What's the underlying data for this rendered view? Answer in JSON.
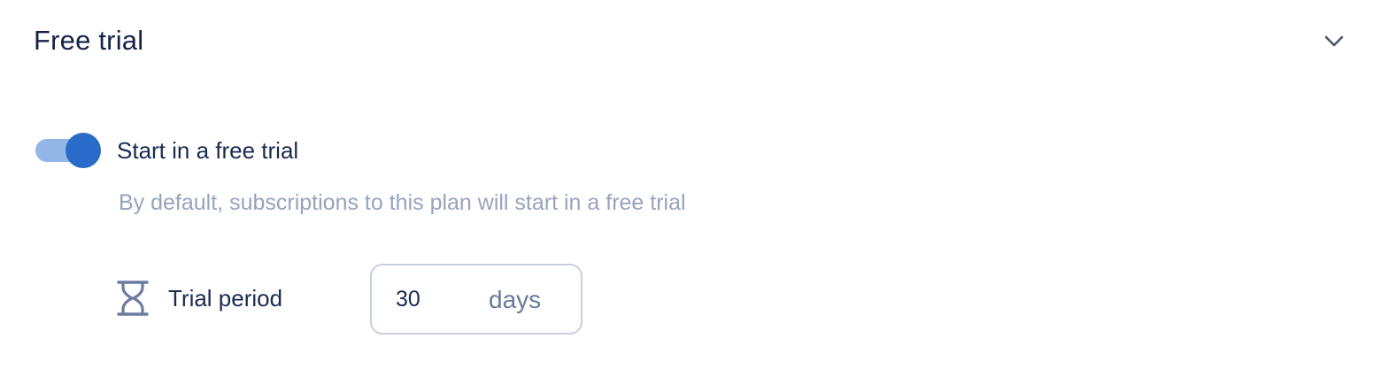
{
  "section": {
    "title": "Free trial",
    "collapse_icon": "chevron-down-icon"
  },
  "toggle": {
    "label": "Start in a free trial",
    "checked": true,
    "track_color": "#93b6e6",
    "knob_color": "#2a6bc9"
  },
  "helper_text": "By default, subscriptions to this plan will start in a free trial",
  "trial_period": {
    "icon": "hourglass-icon",
    "label": "Trial period",
    "value": "30",
    "unit": "days"
  }
}
